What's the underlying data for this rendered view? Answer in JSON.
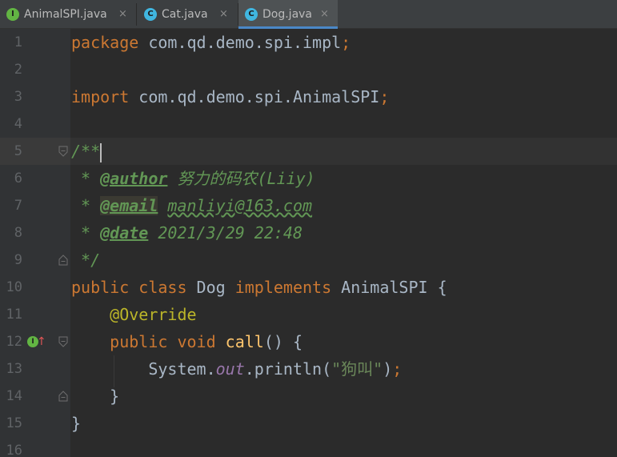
{
  "tabs": [
    {
      "icon": "interface-icon",
      "icon_letter": "I",
      "label": "AnimalSPI.java",
      "close": "×",
      "active": false
    },
    {
      "icon": "class-icon",
      "icon_letter": "C",
      "label": "Cat.java",
      "close": "×",
      "active": false
    },
    {
      "icon": "class-icon",
      "icon_letter": "C",
      "label": "Dog.java",
      "close": "×",
      "active": true
    }
  ],
  "editor": {
    "caret_line": 5,
    "lines": [
      {
        "n": "1"
      },
      {
        "n": "2"
      },
      {
        "n": "3"
      },
      {
        "n": "4"
      },
      {
        "n": "5"
      },
      {
        "n": "6"
      },
      {
        "n": "7"
      },
      {
        "n": "8"
      },
      {
        "n": "9"
      },
      {
        "n": "10"
      },
      {
        "n": "11"
      },
      {
        "n": "12"
      },
      {
        "n": "13"
      },
      {
        "n": "14"
      },
      {
        "n": "15"
      },
      {
        "n": "16"
      }
    ],
    "code": {
      "l1_kw": "package",
      "l1_id": " com.qd.demo.spi.impl",
      "l1_semi": ";",
      "l3_kw": "import",
      "l3_id": " com.qd.demo.spi.AnimalSPI",
      "l3_semi": ";",
      "l5_cmt": "/**",
      "l6_star": " * ",
      "l6_tag": "@author",
      "l6_val": " 努力的码农(Liiy)",
      "l7_star": " * ",
      "l7_tag": "@email",
      "l7_sp": " ",
      "l7_val": "manliyi@163.com",
      "l8_star": " * ",
      "l8_tag": "@date",
      "l8_val": " 2021/3/29 22:48",
      "l9_cmt": " */",
      "l10_kw1": "public class",
      "l10_id1": " Dog ",
      "l10_kw2": "implements",
      "l10_id2": " AnimalSPI {",
      "l11_indent": "    ",
      "l11_ann": "@Override",
      "l12_indent": "    ",
      "l12_kw": "public void",
      "l12_sp": " ",
      "l12_fn": "call",
      "l12_rest": "() {",
      "l13_indent": "        ",
      "l13_id1": "System.",
      "l13_field": "out",
      "l13_id2": ".println(",
      "l13_str": "\"狗叫\"",
      "l13_id3": ")",
      "l13_semi": ";",
      "l14_close": "    }",
      "l15_close": "}"
    },
    "gutter_markers": {
      "implements_badge_letter": "I",
      "implements_arrow": "↑"
    }
  }
}
